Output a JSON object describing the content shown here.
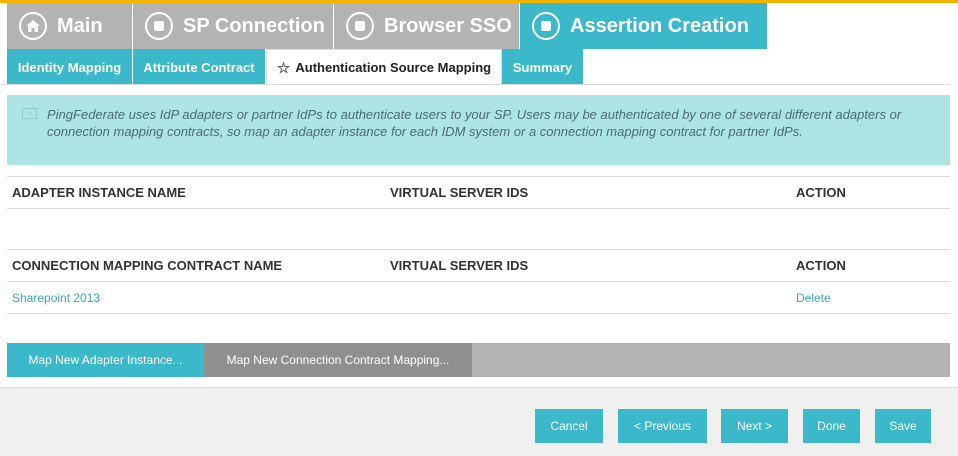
{
  "main_tabs": [
    {
      "label": "Main",
      "icon": "home-icon"
    },
    {
      "label": "SP Connection",
      "icon": "stop-icon"
    },
    {
      "label": "Browser SSO",
      "icon": "stop-icon"
    },
    {
      "label": "Assertion Creation",
      "icon": "stop-icon",
      "active": true
    }
  ],
  "sub_tabs": [
    {
      "label": "Identity Mapping"
    },
    {
      "label": "Attribute Contract"
    },
    {
      "label": "Authentication Source Mapping",
      "active": true,
      "icon": "star-icon"
    },
    {
      "label": "Summary"
    }
  ],
  "info": {
    "text": "PingFederate uses IdP adapters or partner IdPs to authenticate users to your SP. Users may be authenticated by one of several different adapters or connection mapping contracts, so map an adapter instance for each IDM system or a connection mapping contract for partner IdPs."
  },
  "adapter_table": {
    "headers": [
      "ADAPTER INSTANCE NAME",
      "VIRTUAL SERVER IDS",
      "ACTION"
    ],
    "rows": []
  },
  "contract_table": {
    "headers": [
      "CONNECTION MAPPING CONTRACT NAME",
      "VIRTUAL SERVER IDS",
      "ACTION"
    ],
    "rows": [
      {
        "name": "Sharepoint 2013",
        "virtual_server_ids": "",
        "action": "Delete"
      }
    ]
  },
  "map_buttons": {
    "adapter": "Map New Adapter Instance...",
    "contract": "Map New Connection Contract Mapping..."
  },
  "footer": {
    "cancel": "Cancel",
    "previous": "< Previous",
    "next": "Next >",
    "done": "Done",
    "save": "Save"
  },
  "colors": {
    "accent": "#3bb8c9",
    "inactive_tab": "#b3b3b3",
    "info_bg": "#ade4e4",
    "top_bar": "#f2b400",
    "link": "#3ba6c6"
  }
}
